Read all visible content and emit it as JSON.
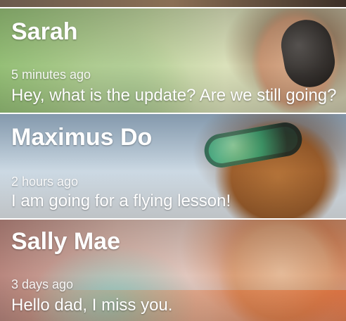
{
  "conversations": [
    {
      "name": "Sarah",
      "time": "5 minutes ago",
      "message": "Hey, what is the update? Are we still going?"
    },
    {
      "name": "Maximus Do",
      "time": "2 hours ago",
      "message": "I am going for a flying lesson!"
    },
    {
      "name": "Sally Mae",
      "time": "3 days ago",
      "message": "Hello dad, I miss you."
    }
  ]
}
